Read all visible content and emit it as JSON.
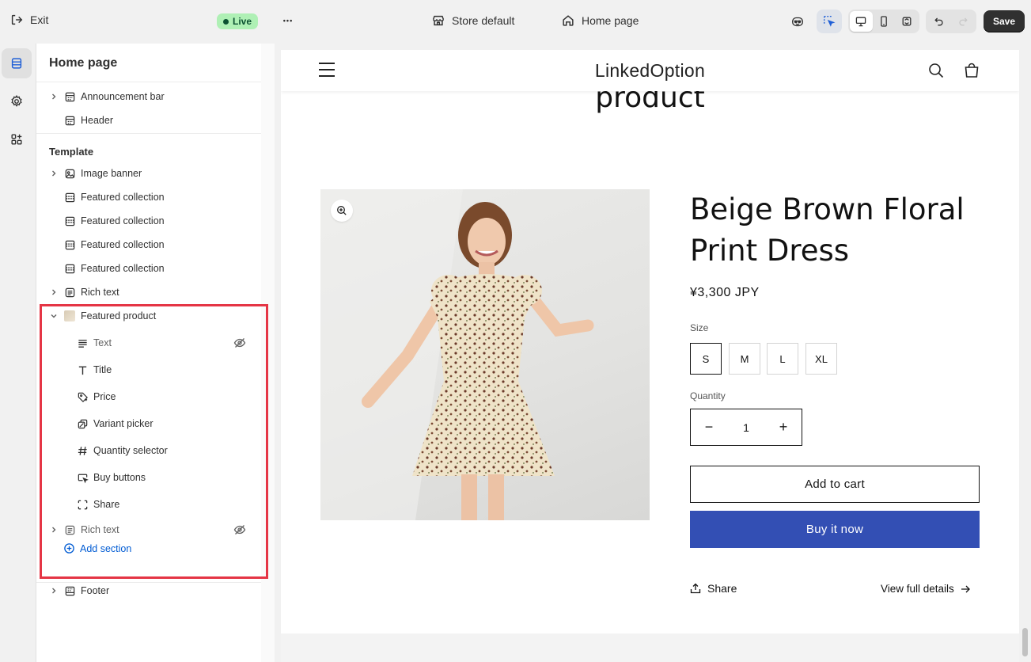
{
  "topbar": {
    "exit_label": "Exit",
    "live_label": "Live",
    "more_label": "•••",
    "store_label": "Store default",
    "page_label": "Home page",
    "save_label": "Save"
  },
  "sidebar": {
    "title": "Home page",
    "header_group": [
      {
        "label": "Announcement bar",
        "icon": "layout-header-icon",
        "expandable": true
      },
      {
        "label": "Header",
        "icon": "layout-header-icon",
        "expandable": false
      }
    ],
    "template_label": "Template",
    "template_sections": [
      {
        "label": "Image banner",
        "icon": "image-banner-icon",
        "expandable": true
      },
      {
        "label": "Featured collection",
        "icon": "collection-icon",
        "expandable": false
      },
      {
        "label": "Featured collection",
        "icon": "collection-icon",
        "expandable": false
      },
      {
        "label": "Featured collection",
        "icon": "collection-icon",
        "expandable": false
      },
      {
        "label": "Featured collection",
        "icon": "collection-icon",
        "expandable": false
      },
      {
        "label": "Rich text",
        "icon": "text-block-icon",
        "expandable": true
      }
    ],
    "featured_product": {
      "label": "Featured product",
      "blocks": [
        {
          "label": "Text",
          "icon": "text-lines-icon",
          "hidden": true
        },
        {
          "label": "Title",
          "icon": "title-t-icon",
          "hidden": false
        },
        {
          "label": "Price",
          "icon": "price-tag-icon",
          "hidden": false
        },
        {
          "label": "Variant picker",
          "icon": "variant-icon",
          "hidden": false
        },
        {
          "label": "Quantity selector",
          "icon": "hash-icon",
          "hidden": false
        },
        {
          "label": "Buy buttons",
          "icon": "cursor-click-icon",
          "hidden": false
        },
        {
          "label": "Share",
          "icon": "share-frame-icon",
          "hidden": false
        }
      ]
    },
    "rich_text_hidden": {
      "label": "Rich text",
      "hidden": true
    },
    "add_section_label": "Add section",
    "footer_label": "Footer",
    "highlight_color": "#e53545"
  },
  "preview": {
    "store_name": "LinkedOption",
    "section_heading": "product",
    "product_title": "Beige Brown Floral Print Dress",
    "price": "¥3,300 JPY",
    "size_label": "Size",
    "sizes": [
      "S",
      "M",
      "L",
      "XL"
    ],
    "selected_size": "S",
    "quantity_label": "Quantity",
    "quantity_value": "1",
    "qty_minus": "−",
    "qty_plus": "+",
    "add_to_cart": "Add to cart",
    "buy_now": "Buy it now",
    "share_label": "Share",
    "view_details": "View full details",
    "buy_now_color": "#334fb4"
  }
}
